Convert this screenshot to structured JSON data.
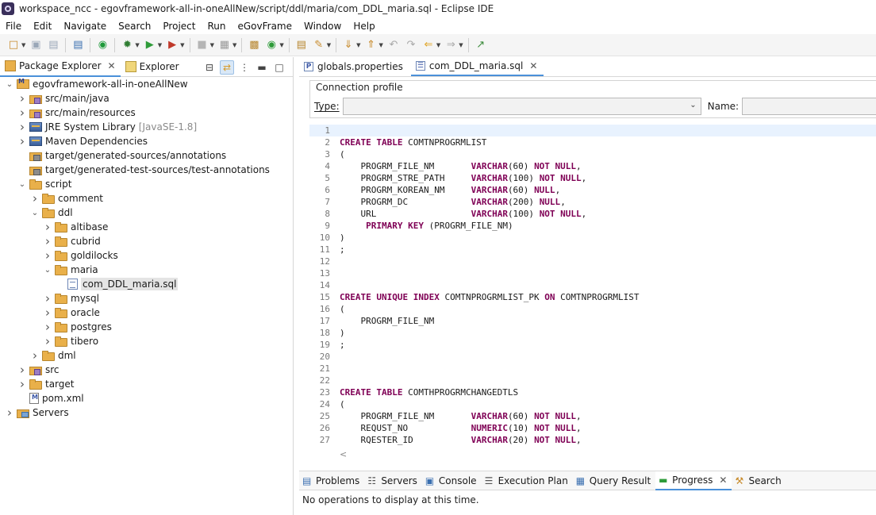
{
  "window": {
    "title": "workspace_ncc - egovframework-all-in-oneAllNew/script/ddl/maria/com_DDL_maria.sql - Eclipse IDE"
  },
  "menu": [
    "File",
    "Edit",
    "Navigate",
    "Search",
    "Project",
    "Run",
    "eGovFrame",
    "Window",
    "Help"
  ],
  "left_panel": {
    "tabs": [
      {
        "label": "Package Explorer",
        "active": true
      },
      {
        "label": "Explorer",
        "active": false
      }
    ],
    "tree": [
      {
        "label": "egovframework-all-in-oneAllNew",
        "decor": "",
        "depth": 0,
        "twisty": "open",
        "icon": "project"
      },
      {
        "label": "src/main/java",
        "decor": "",
        "depth": 1,
        "twisty": "closed",
        "icon": "pkgfolder"
      },
      {
        "label": "src/main/resources",
        "decor": "",
        "depth": 1,
        "twisty": "closed",
        "icon": "pkgfolder"
      },
      {
        "label": "JRE System Library",
        "decor": "[JavaSE-1.8]",
        "depth": 1,
        "twisty": "closed",
        "icon": "jar"
      },
      {
        "label": "Maven Dependencies",
        "decor": "",
        "depth": 1,
        "twisty": "closed",
        "icon": "jar"
      },
      {
        "label": "target/generated-sources/annotations",
        "decor": "",
        "depth": 1,
        "twisty": "none",
        "icon": "gen"
      },
      {
        "label": "target/generated-test-sources/test-annotations",
        "decor": "",
        "depth": 1,
        "twisty": "none",
        "icon": "gen"
      },
      {
        "label": "script",
        "decor": "",
        "depth": 1,
        "twisty": "open",
        "icon": "folder"
      },
      {
        "label": "comment",
        "decor": "",
        "depth": 2,
        "twisty": "closed",
        "icon": "folder"
      },
      {
        "label": "ddl",
        "decor": "",
        "depth": 2,
        "twisty": "open",
        "icon": "folder"
      },
      {
        "label": "altibase",
        "decor": "",
        "depth": 3,
        "twisty": "closed",
        "icon": "folder"
      },
      {
        "label": "cubrid",
        "decor": "",
        "depth": 3,
        "twisty": "closed",
        "icon": "folder"
      },
      {
        "label": "goldilocks",
        "decor": "",
        "depth": 3,
        "twisty": "closed",
        "icon": "folder"
      },
      {
        "label": "maria",
        "decor": "",
        "depth": 3,
        "twisty": "open",
        "icon": "folder"
      },
      {
        "label": "com_DDL_maria.sql",
        "decor": "",
        "depth": 4,
        "twisty": "none",
        "icon": "sql",
        "selected": true
      },
      {
        "label": "mysql",
        "decor": "",
        "depth": 3,
        "twisty": "closed",
        "icon": "folder"
      },
      {
        "label": "oracle",
        "decor": "",
        "depth": 3,
        "twisty": "closed",
        "icon": "folder"
      },
      {
        "label": "postgres",
        "decor": "",
        "depth": 3,
        "twisty": "closed",
        "icon": "folder"
      },
      {
        "label": "tibero",
        "decor": "",
        "depth": 3,
        "twisty": "closed",
        "icon": "folder"
      },
      {
        "label": "dml",
        "decor": "",
        "depth": 2,
        "twisty": "closed",
        "icon": "folder"
      },
      {
        "label": "src",
        "decor": "",
        "depth": 1,
        "twisty": "closed",
        "icon": "pkgfolder"
      },
      {
        "label": "target",
        "decor": "",
        "depth": 1,
        "twisty": "closed",
        "icon": "folder"
      },
      {
        "label": "pom.xml",
        "decor": "",
        "depth": 1,
        "twisty": "none",
        "icon": "xml"
      },
      {
        "label": "Servers",
        "decor": "",
        "depth": 0,
        "twisty": "closed",
        "icon": "servers"
      }
    ]
  },
  "editor": {
    "tabs": [
      {
        "label": "globals.properties",
        "active": false,
        "closable": false
      },
      {
        "label": "com_DDL_maria.sql",
        "active": true,
        "closable": true
      }
    ],
    "connection_profile": {
      "title": "Connection profile",
      "type_label": "Type:",
      "type_value": "",
      "name_label": "Name:",
      "name_value": ""
    },
    "lines": [
      [],
      [
        [
          "k",
          "CREATE TABLE "
        ],
        [
          "t",
          "COMTNPROGRMLIST"
        ]
      ],
      [
        [
          "t",
          "("
        ]
      ],
      [
        [
          "t",
          "    PROGRM_FILE_NM       "
        ],
        [
          "k",
          "VARCHAR"
        ],
        [
          "t",
          "(60) "
        ],
        [
          "k",
          "NOT NULL"
        ],
        [
          "t",
          ","
        ]
      ],
      [
        [
          "t",
          "    PROGRM_STRE_PATH     "
        ],
        [
          "k",
          "VARCHAR"
        ],
        [
          "t",
          "(100) "
        ],
        [
          "k",
          "NOT NULL"
        ],
        [
          "t",
          ","
        ]
      ],
      [
        [
          "t",
          "    PROGRM_KOREAN_NM     "
        ],
        [
          "k",
          "VARCHAR"
        ],
        [
          "t",
          "(60) "
        ],
        [
          "k",
          "NULL"
        ],
        [
          "t",
          ","
        ]
      ],
      [
        [
          "t",
          "    PROGRM_DC            "
        ],
        [
          "k",
          "VARCHAR"
        ],
        [
          "t",
          "(200) "
        ],
        [
          "k",
          "NULL"
        ],
        [
          "t",
          ","
        ]
      ],
      [
        [
          "t",
          "    URL                  "
        ],
        [
          "k",
          "VARCHAR"
        ],
        [
          "t",
          "(100) "
        ],
        [
          "k",
          "NOT NULL"
        ],
        [
          "t",
          ","
        ]
      ],
      [
        [
          "t",
          "     "
        ],
        [
          "k",
          "PRIMARY KEY"
        ],
        [
          "t",
          " (PROGRM_FILE_NM)"
        ]
      ],
      [
        [
          "t",
          ")"
        ]
      ],
      [
        [
          "t",
          ";"
        ]
      ],
      [],
      [],
      [],
      [
        [
          "k",
          "CREATE UNIQUE INDEX "
        ],
        [
          "t",
          "COMTNPROGRMLIST_PK "
        ],
        [
          "k",
          "ON "
        ],
        [
          "t",
          "COMTNPROGRMLIST"
        ]
      ],
      [
        [
          "t",
          "("
        ]
      ],
      [
        [
          "t",
          "    PROGRM_FILE_NM"
        ]
      ],
      [
        [
          "t",
          ")"
        ]
      ],
      [
        [
          "t",
          ";"
        ]
      ],
      [],
      [],
      [],
      [
        [
          "k",
          "CREATE TABLE "
        ],
        [
          "t",
          "COMTHPROGRMCHANGEDTLS"
        ]
      ],
      [
        [
          "t",
          "("
        ]
      ],
      [
        [
          "t",
          "    PROGRM_FILE_NM       "
        ],
        [
          "k",
          "VARCHAR"
        ],
        [
          "t",
          "(60) "
        ],
        [
          "k",
          "NOT NULL"
        ],
        [
          "t",
          ","
        ]
      ],
      [
        [
          "t",
          "    REQUST_NO            "
        ],
        [
          "k",
          "NUMERIC"
        ],
        [
          "t",
          "(10) "
        ],
        [
          "k",
          "NOT NULL"
        ],
        [
          "t",
          ","
        ]
      ],
      [
        [
          "t",
          "    RQESTER_ID           "
        ],
        [
          "k",
          "VARCHAR"
        ],
        [
          "t",
          "(20) "
        ],
        [
          "k",
          "NOT NULL"
        ],
        [
          "t",
          ","
        ]
      ]
    ],
    "scroll_hint": "<"
  },
  "bottom_panel": {
    "tabs": [
      {
        "label": "Problems",
        "active": false,
        "icon": "problems-icon"
      },
      {
        "label": "Servers",
        "active": false,
        "icon": "servers-icon"
      },
      {
        "label": "Console",
        "active": false,
        "icon": "console-icon"
      },
      {
        "label": "Execution Plan",
        "active": false,
        "icon": "execution-plan-icon"
      },
      {
        "label": "Query Result",
        "active": false,
        "icon": "query-result-icon"
      },
      {
        "label": "Progress",
        "active": true,
        "icon": "progress-icon"
      },
      {
        "label": "Search",
        "active": false,
        "icon": "search-icon"
      }
    ],
    "message": "No operations to display at this time."
  },
  "colors": {
    "keyword": "#7f0055",
    "active_tab_underline": "#4a90d9",
    "current_line": "#e8f2fe",
    "selection": "#e4e4e4"
  }
}
